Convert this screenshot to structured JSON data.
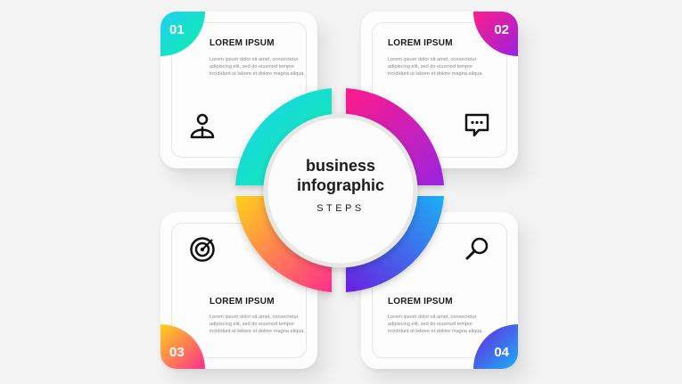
{
  "steps": [
    {
      "number": "01",
      "title": "LOREM IPSUM",
      "text": "Lorem ipsum dolor sit amet, consectetur adipiscing elit, sed do eiusmod tempor incididunt ut labore et dolore magna aliqua.",
      "icon": "person-icon",
      "colors": [
        "#1fd0f0",
        "#0ef0a8"
      ]
    },
    {
      "number": "02",
      "title": "LOREM IPSUM",
      "text": "Lorem ipsum dolor sit amet, consectetur adipiscing elit, sed do eiusmod tempor incididunt ut labore et dolore magna aliqua.",
      "icon": "chat-icon",
      "colors": [
        "#ff1d8a",
        "#9b22e0"
      ]
    },
    {
      "number": "03",
      "title": "LOREM IPSUM",
      "text": "Lorem ipsum dolor sit amet, consectetur adipiscing elit, sed do eiusmod tempor incididunt ut labore et dolore magna aliqua.",
      "icon": "target-icon",
      "colors": [
        "#ffd21a",
        "#ff2e8c"
      ]
    },
    {
      "number": "04",
      "title": "LOREM IPSUM",
      "text": "Lorem ipsum dolor sit amet, consectetur adipiscing elit, sed do eiusmod tempor incididunt ut labore et dolore magna aliqua.",
      "icon": "search-icon",
      "colors": [
        "#6a1fe0",
        "#1ab0f5"
      ]
    }
  ],
  "center": {
    "title_line1": "business",
    "title_line2": "infographic",
    "subtitle": "STEPS"
  }
}
